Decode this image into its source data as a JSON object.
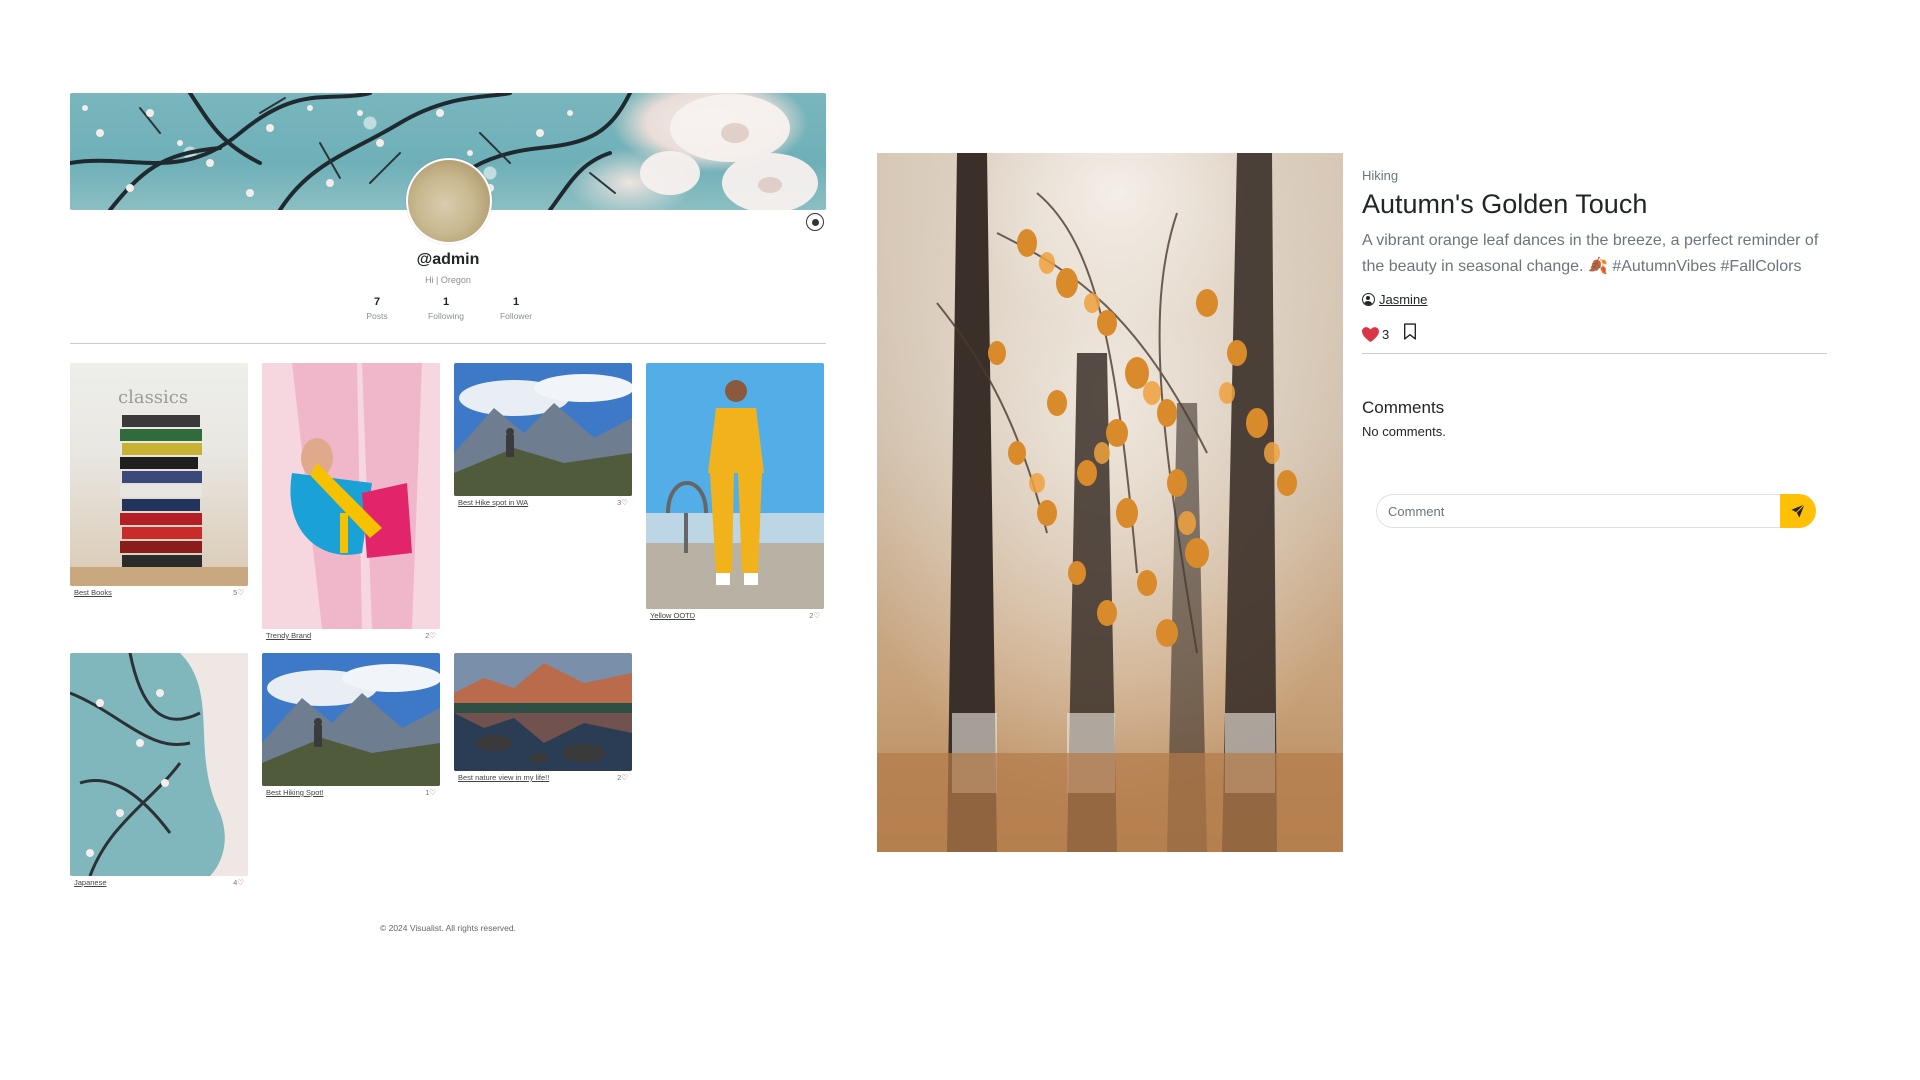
{
  "profile": {
    "username": "@admin",
    "bio": "Hi | Oregon",
    "stats": [
      {
        "value": "7",
        "label": "Posts"
      },
      {
        "value": "1",
        "label": "Following"
      },
      {
        "value": "1",
        "label": "Follower"
      }
    ],
    "settings_icon": "settings-icon"
  },
  "grid": [
    {
      "caption": "Best Books",
      "likes": "5",
      "thumb": "books"
    },
    {
      "caption": "Trendy Brand",
      "likes": "2",
      "thumb": "fashion"
    },
    {
      "caption": "Best Hike spot in WA",
      "likes": "3",
      "thumb": "mountain"
    },
    {
      "caption": "Yellow OOTD",
      "likes": "2",
      "thumb": "yellow"
    },
    {
      "caption": "Japanese",
      "likes": "4",
      "thumb": "blossom"
    },
    {
      "caption": "Best Hiking Spot!",
      "likes": "1",
      "thumb": "mountain"
    },
    {
      "caption": "Best nature view in my life!!",
      "likes": "2",
      "thumb": "lake"
    }
  ],
  "footer": "© 2024 Visualist. All rights reserved.",
  "post": {
    "category": "Hiking",
    "title": "Autumn's Golden Touch",
    "description": "A vibrant orange leaf dances in the breeze, a perfect reminder of the beauty in seasonal change. 🍂 #AutumnVibes #FallColors",
    "author": "Jasmine",
    "likes": "3",
    "comments_title": "Comments",
    "no_comments": "No comments.",
    "comment_placeholder": "Comment"
  },
  "colors": {
    "accent": "#ffc107",
    "like": "#dc3545"
  }
}
